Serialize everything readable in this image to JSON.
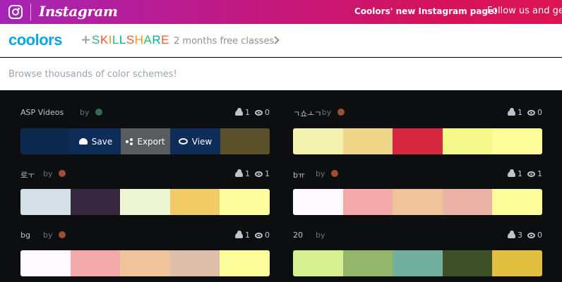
{
  "banner": {
    "app_name": "Instagram",
    "promo": "Coolors' new Instagram page!",
    "follow": "Follow us and get"
  },
  "sponsor": {
    "brand": "coolors",
    "plus": "+",
    "partner": "SKILLSHARE",
    "offer": "2 months free classes"
  },
  "search": {
    "placeholder": "Browse thousands of color schemes!"
  },
  "palettes": [
    {
      "name": "ASP Videos",
      "by": "by",
      "likes": "1",
      "views": "0",
      "dot": "#2f6d54",
      "colors": [
        "#0b2a4d",
        "#0b2a4d",
        "#0b2a4d",
        "#0b2a4d",
        "#5a5029"
      ],
      "actions": {
        "save": "Save",
        "export": "Export",
        "view": "View"
      }
    },
    {
      "name": "ㄱ쇼ㅗㄱ",
      "by": "by",
      "likes": "1",
      "views": "0",
      "dot": "#9c4f36",
      "colors": [
        "#f2f2ae",
        "#efd587",
        "#d62640",
        "#f5f98b",
        "#fdfd9c"
      ]
    },
    {
      "name": "로ㅜ",
      "by": "by",
      "likes": "1",
      "views": "1",
      "dot": "#9c4f36",
      "colors": [
        "#d5dfe8",
        "#35283f",
        "#edf5d2",
        "#f3cb66",
        "#fefe9e"
      ]
    },
    {
      "name": "bㅠ",
      "by": "by",
      "likes": "1",
      "views": "1",
      "dot": "#9c4f36",
      "colors": [
        "#fef9fd",
        "#f4aaaa",
        "#f0c49b",
        "#ebb3a8",
        "#fcfd9b"
      ]
    },
    {
      "name": "bg",
      "by": "by",
      "likes": "1",
      "views": "0",
      "dot": "#9c4f36",
      "colors": [
        "#fef9fd",
        "#f4aaaa",
        "#f0c49b",
        "#dfbfa9",
        "#fcfd9b"
      ]
    },
    {
      "name": "20",
      "by": "by",
      "likes": "3",
      "views": "0",
      "dot": "",
      "colors": [
        "#d6f090",
        "#95b76c",
        "#73af9d",
        "#3e5026",
        "#e3bf41"
      ]
    }
  ]
}
